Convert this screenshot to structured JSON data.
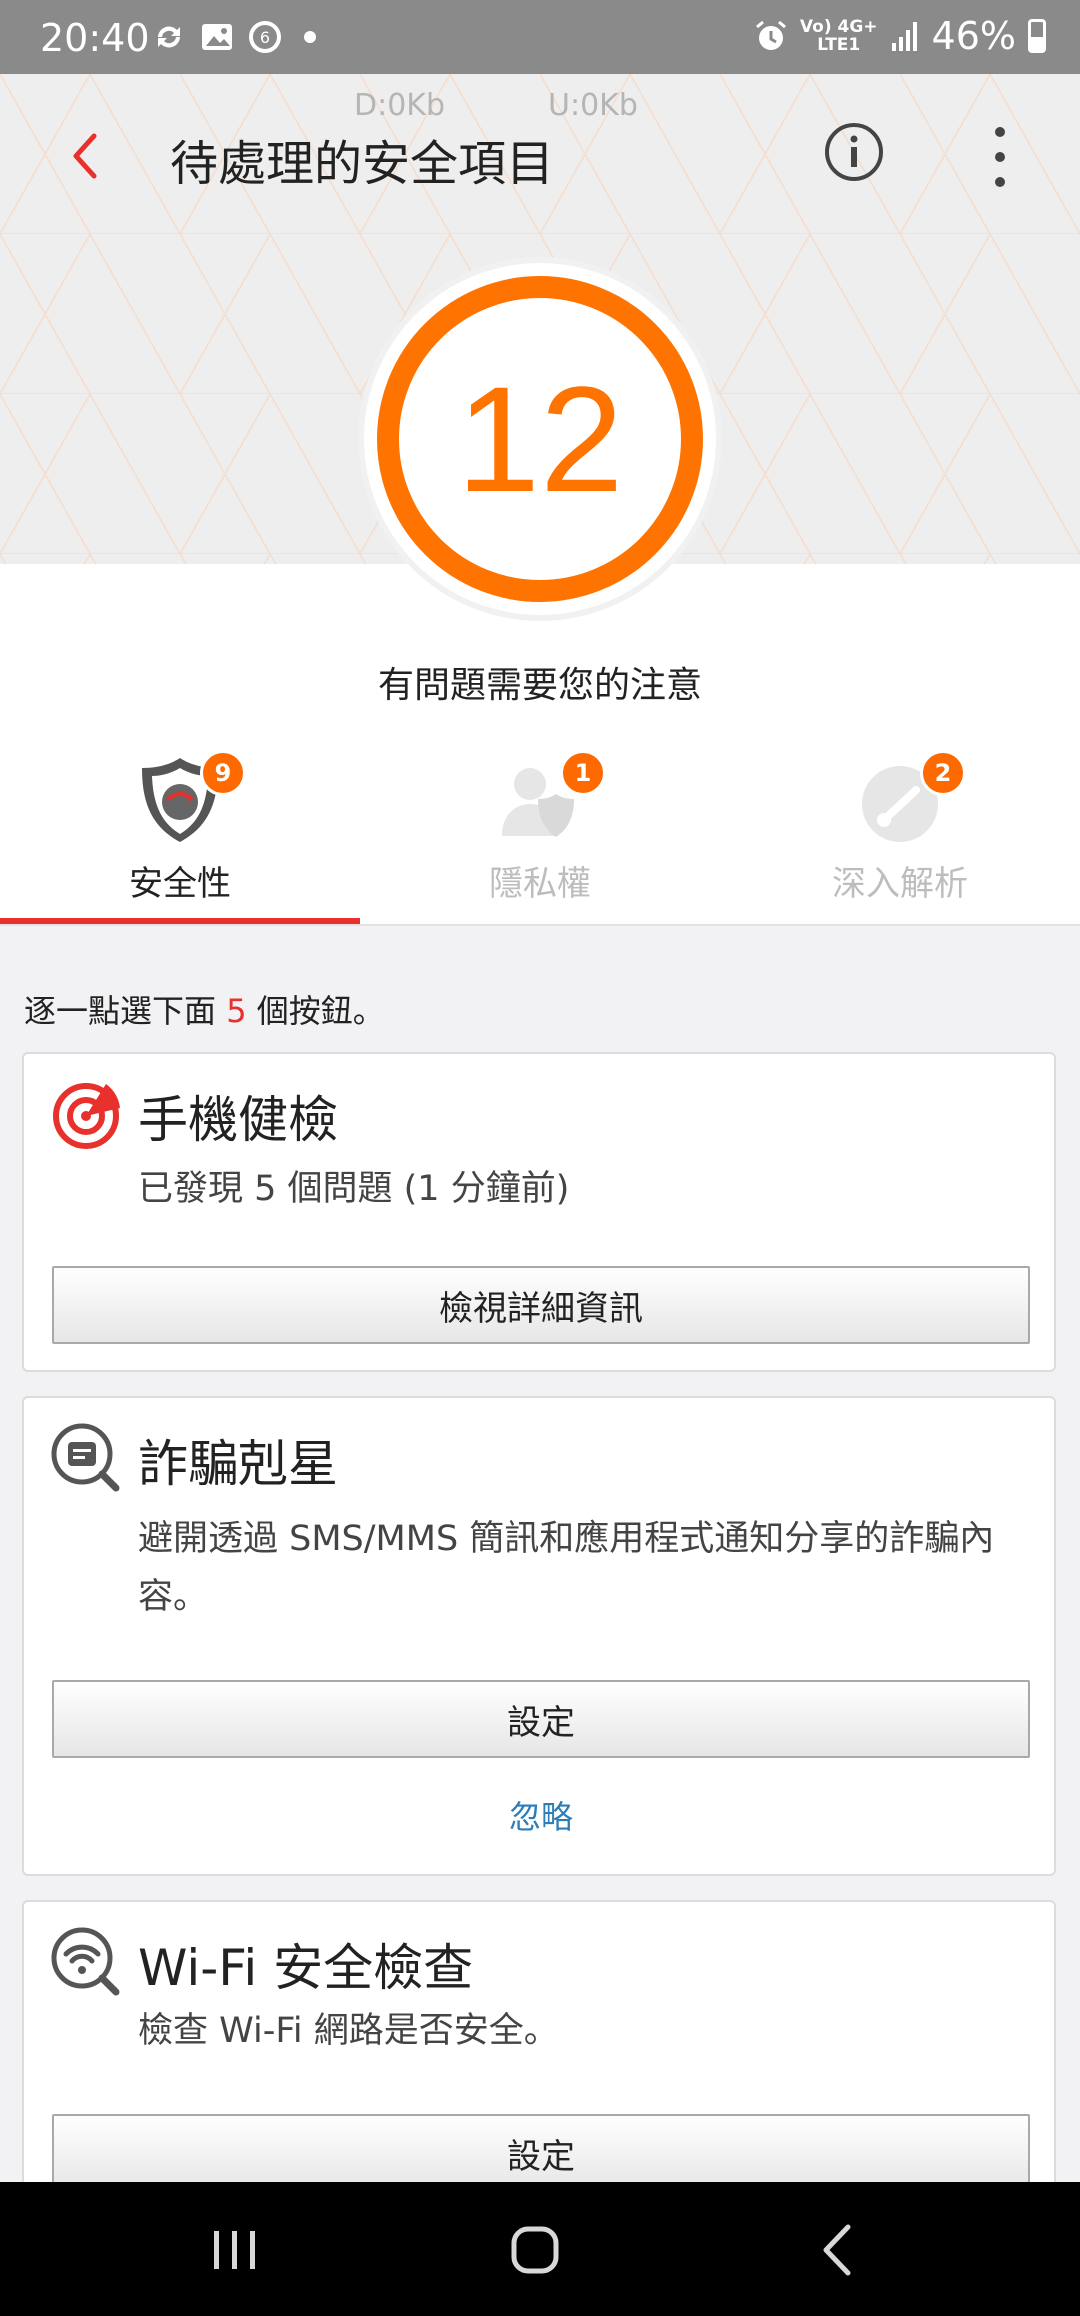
{
  "status_bar": {
    "time": "20:40",
    "net_line1": "Vo) 4G+",
    "net_line2": "LTE1",
    "battery": "46%",
    "battery_level": 0.46
  },
  "header": {
    "download_speed": "D:0Kb",
    "upload_speed": "U:0Kb",
    "title": "待處理的安全項目",
    "accent_color": "#ff7300"
  },
  "summary": {
    "count": "12",
    "message": "有問題需要您的注意"
  },
  "tabs": [
    {
      "label": "安全性",
      "badge": "9",
      "active": true
    },
    {
      "label": "隱私權",
      "badge": "1",
      "active": false
    },
    {
      "label": "深入解析",
      "badge": "2",
      "active": false
    }
  ],
  "instruction": {
    "prefix": "逐一點選下面",
    "number": "5",
    "suffix": "個按鈕。"
  },
  "cards": [
    {
      "title": "手機健檢",
      "description": "已發現 5 個問題 (1 分鐘前)",
      "button": "檢視詳細資訊",
      "icon": "radar-scan-icon"
    },
    {
      "title": "詐騙剋星",
      "description": "避開透過 SMS/MMS 簡訊和應用程式通知分享的詐騙內容。",
      "button": "設定",
      "link": "忽略",
      "icon": "message-search-icon"
    },
    {
      "title": "Wi-Fi 安全檢查",
      "description": "檢查 Wi-Fi 網路是否安全。",
      "button": "設定",
      "icon": "wifi-search-icon"
    }
  ]
}
